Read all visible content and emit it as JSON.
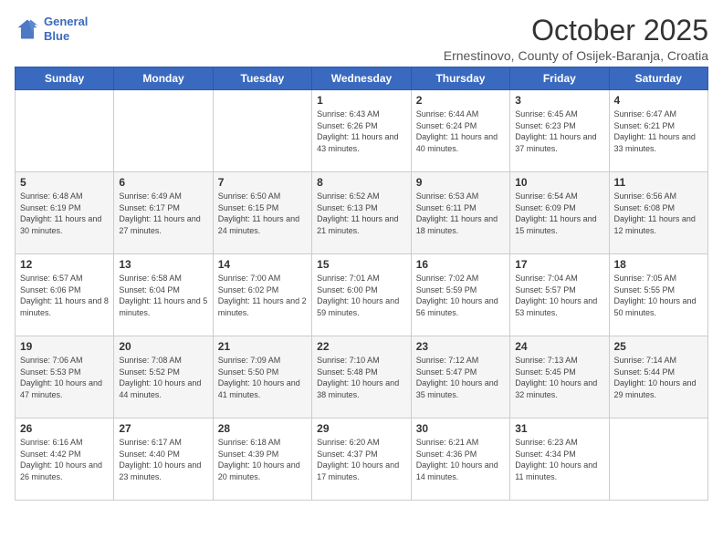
{
  "header": {
    "logo_line1": "General",
    "logo_line2": "Blue",
    "month_title": "October 2025",
    "location": "Ernestinovo, County of Osijek-Baranja, Croatia"
  },
  "weekdays": [
    "Sunday",
    "Monday",
    "Tuesday",
    "Wednesday",
    "Thursday",
    "Friday",
    "Saturday"
  ],
  "weeks": [
    [
      {
        "day": "",
        "sunrise": "",
        "sunset": "",
        "daylight": ""
      },
      {
        "day": "",
        "sunrise": "",
        "sunset": "",
        "daylight": ""
      },
      {
        "day": "",
        "sunrise": "",
        "sunset": "",
        "daylight": ""
      },
      {
        "day": "1",
        "sunrise": "Sunrise: 6:43 AM",
        "sunset": "Sunset: 6:26 PM",
        "daylight": "Daylight: 11 hours and 43 minutes."
      },
      {
        "day": "2",
        "sunrise": "Sunrise: 6:44 AM",
        "sunset": "Sunset: 6:24 PM",
        "daylight": "Daylight: 11 hours and 40 minutes."
      },
      {
        "day": "3",
        "sunrise": "Sunrise: 6:45 AM",
        "sunset": "Sunset: 6:23 PM",
        "daylight": "Daylight: 11 hours and 37 minutes."
      },
      {
        "day": "4",
        "sunrise": "Sunrise: 6:47 AM",
        "sunset": "Sunset: 6:21 PM",
        "daylight": "Daylight: 11 hours and 33 minutes."
      }
    ],
    [
      {
        "day": "5",
        "sunrise": "Sunrise: 6:48 AM",
        "sunset": "Sunset: 6:19 PM",
        "daylight": "Daylight: 11 hours and 30 minutes."
      },
      {
        "day": "6",
        "sunrise": "Sunrise: 6:49 AM",
        "sunset": "Sunset: 6:17 PM",
        "daylight": "Daylight: 11 hours and 27 minutes."
      },
      {
        "day": "7",
        "sunrise": "Sunrise: 6:50 AM",
        "sunset": "Sunset: 6:15 PM",
        "daylight": "Daylight: 11 hours and 24 minutes."
      },
      {
        "day": "8",
        "sunrise": "Sunrise: 6:52 AM",
        "sunset": "Sunset: 6:13 PM",
        "daylight": "Daylight: 11 hours and 21 minutes."
      },
      {
        "day": "9",
        "sunrise": "Sunrise: 6:53 AM",
        "sunset": "Sunset: 6:11 PM",
        "daylight": "Daylight: 11 hours and 18 minutes."
      },
      {
        "day": "10",
        "sunrise": "Sunrise: 6:54 AM",
        "sunset": "Sunset: 6:09 PM",
        "daylight": "Daylight: 11 hours and 15 minutes."
      },
      {
        "day": "11",
        "sunrise": "Sunrise: 6:56 AM",
        "sunset": "Sunset: 6:08 PM",
        "daylight": "Daylight: 11 hours and 12 minutes."
      }
    ],
    [
      {
        "day": "12",
        "sunrise": "Sunrise: 6:57 AM",
        "sunset": "Sunset: 6:06 PM",
        "daylight": "Daylight: 11 hours and 8 minutes."
      },
      {
        "day": "13",
        "sunrise": "Sunrise: 6:58 AM",
        "sunset": "Sunset: 6:04 PM",
        "daylight": "Daylight: 11 hours and 5 minutes."
      },
      {
        "day": "14",
        "sunrise": "Sunrise: 7:00 AM",
        "sunset": "Sunset: 6:02 PM",
        "daylight": "Daylight: 11 hours and 2 minutes."
      },
      {
        "day": "15",
        "sunrise": "Sunrise: 7:01 AM",
        "sunset": "Sunset: 6:00 PM",
        "daylight": "Daylight: 10 hours and 59 minutes."
      },
      {
        "day": "16",
        "sunrise": "Sunrise: 7:02 AM",
        "sunset": "Sunset: 5:59 PM",
        "daylight": "Daylight: 10 hours and 56 minutes."
      },
      {
        "day": "17",
        "sunrise": "Sunrise: 7:04 AM",
        "sunset": "Sunset: 5:57 PM",
        "daylight": "Daylight: 10 hours and 53 minutes."
      },
      {
        "day": "18",
        "sunrise": "Sunrise: 7:05 AM",
        "sunset": "Sunset: 5:55 PM",
        "daylight": "Daylight: 10 hours and 50 minutes."
      }
    ],
    [
      {
        "day": "19",
        "sunrise": "Sunrise: 7:06 AM",
        "sunset": "Sunset: 5:53 PM",
        "daylight": "Daylight: 10 hours and 47 minutes."
      },
      {
        "day": "20",
        "sunrise": "Sunrise: 7:08 AM",
        "sunset": "Sunset: 5:52 PM",
        "daylight": "Daylight: 10 hours and 44 minutes."
      },
      {
        "day": "21",
        "sunrise": "Sunrise: 7:09 AM",
        "sunset": "Sunset: 5:50 PM",
        "daylight": "Daylight: 10 hours and 41 minutes."
      },
      {
        "day": "22",
        "sunrise": "Sunrise: 7:10 AM",
        "sunset": "Sunset: 5:48 PM",
        "daylight": "Daylight: 10 hours and 38 minutes."
      },
      {
        "day": "23",
        "sunrise": "Sunrise: 7:12 AM",
        "sunset": "Sunset: 5:47 PM",
        "daylight": "Daylight: 10 hours and 35 minutes."
      },
      {
        "day": "24",
        "sunrise": "Sunrise: 7:13 AM",
        "sunset": "Sunset: 5:45 PM",
        "daylight": "Daylight: 10 hours and 32 minutes."
      },
      {
        "day": "25",
        "sunrise": "Sunrise: 7:14 AM",
        "sunset": "Sunset: 5:44 PM",
        "daylight": "Daylight: 10 hours and 29 minutes."
      }
    ],
    [
      {
        "day": "26",
        "sunrise": "Sunrise: 6:16 AM",
        "sunset": "Sunset: 4:42 PM",
        "daylight": "Daylight: 10 hours and 26 minutes."
      },
      {
        "day": "27",
        "sunrise": "Sunrise: 6:17 AM",
        "sunset": "Sunset: 4:40 PM",
        "daylight": "Daylight: 10 hours and 23 minutes."
      },
      {
        "day": "28",
        "sunrise": "Sunrise: 6:18 AM",
        "sunset": "Sunset: 4:39 PM",
        "daylight": "Daylight: 10 hours and 20 minutes."
      },
      {
        "day": "29",
        "sunrise": "Sunrise: 6:20 AM",
        "sunset": "Sunset: 4:37 PM",
        "daylight": "Daylight: 10 hours and 17 minutes."
      },
      {
        "day": "30",
        "sunrise": "Sunrise: 6:21 AM",
        "sunset": "Sunset: 4:36 PM",
        "daylight": "Daylight: 10 hours and 14 minutes."
      },
      {
        "day": "31",
        "sunrise": "Sunrise: 6:23 AM",
        "sunset": "Sunset: 4:34 PM",
        "daylight": "Daylight: 10 hours and 11 minutes."
      },
      {
        "day": "",
        "sunrise": "",
        "sunset": "",
        "daylight": ""
      }
    ]
  ]
}
